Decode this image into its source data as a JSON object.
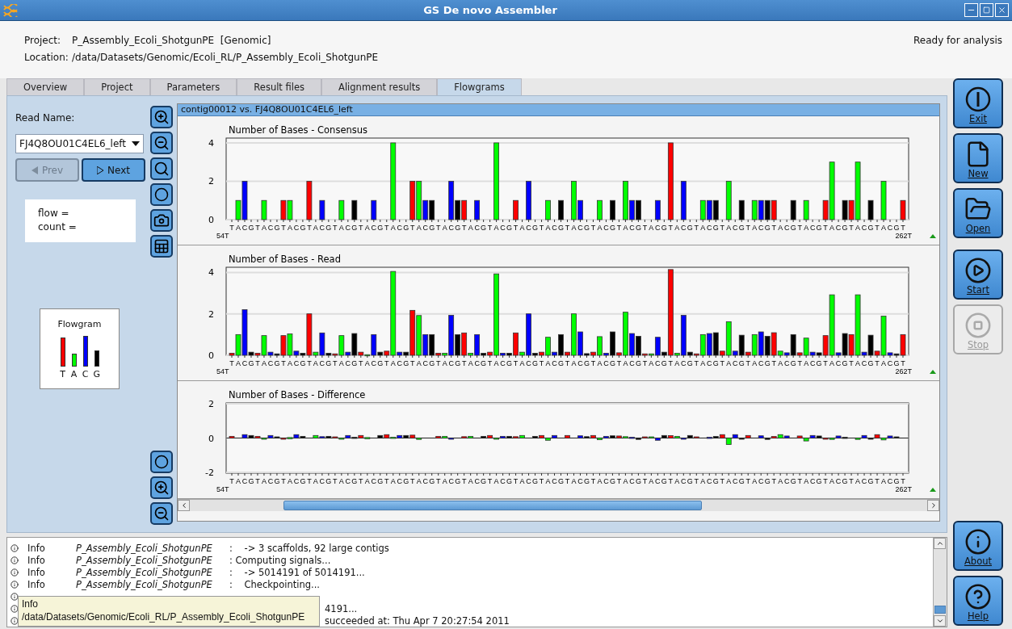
{
  "window": {
    "title": "GS De novo Assembler"
  },
  "header": {
    "project_label": "Project:",
    "project": "P_Assembly_Ecoli_ShotgunPE  [Genomic]",
    "location_label": "Location:",
    "location": "/data/Datasets/Genomic/Ecoli_RL/P_Assembly_Ecoli_ShotgunPE",
    "status": "Ready for analysis"
  },
  "tabs": [
    {
      "label": "Overview",
      "selected": false
    },
    {
      "label": "Project",
      "selected": false
    },
    {
      "label": "Parameters",
      "selected": false
    },
    {
      "label": "Result files",
      "selected": false
    },
    {
      "label": "Alignment results",
      "selected": false
    },
    {
      "label": "Flowgrams",
      "selected": true
    }
  ],
  "read_panel": {
    "label": "Read Name:",
    "read_name": "FJ4Q8OU01C4EL6_left",
    "buttons": [
      {
        "label": "Prev",
        "kind": "prev",
        "disabled": true
      },
      {
        "label": "Next",
        "kind": "next",
        "disabled": false
      }
    ],
    "info_lines": [
      "flow =",
      "count ="
    ],
    "legend": {
      "title": "Flowgram",
      "bases": [
        {
          "label": "T",
          "color": "#ff0000"
        },
        {
          "label": "A",
          "color": "#00ff00"
        },
        {
          "label": "C",
          "color": "#0000ff"
        },
        {
          "label": "G",
          "color": "#000000"
        }
      ]
    }
  },
  "flowgram": {
    "title": "contig00012 vs. FJ4Q8OU01C4EL6_left",
    "charts": [
      {
        "start_label": "54T",
        "end_label": "262T",
        "chart_data": {
          "type": "bar",
          "title": "Number of Bases - Consensus",
          "ylim": [
            0,
            4.25
          ],
          "yticks": [
            0,
            2,
            4
          ],
          "categories": [
            "T",
            "A",
            "C",
            "G",
            "T",
            "A",
            "C",
            "G",
            "T",
            "A",
            "C",
            "G",
            "T",
            "A",
            "C",
            "G",
            "T",
            "A",
            "C",
            "G",
            "T",
            "A",
            "C",
            "G",
            "T",
            "A",
            "C",
            "G",
            "T",
            "A",
            "C",
            "G",
            "T",
            "A",
            "C",
            "G",
            "T",
            "A",
            "C",
            "G",
            "T",
            "A",
            "C",
            "G",
            "T",
            "A",
            "C",
            "G",
            "T",
            "A",
            "C",
            "G",
            "T",
            "A",
            "C",
            "G",
            "T",
            "A",
            "C",
            "G",
            "T",
            "A",
            "C",
            "G",
            "T",
            "A",
            "C",
            "G",
            "T",
            "A",
            "C",
            "G",
            "T",
            "A",
            "C",
            "G",
            "T",
            "A",
            "C",
            "G",
            "T",
            "A",
            "C",
            "G",
            "T",
            "A",
            "C",
            "G",
            "T",
            "A",
            "C",
            "G",
            "T",
            "A",
            "C",
            "G",
            "T",
            "A",
            "C",
            "G",
            "T",
            "A",
            "C",
            "G",
            "T"
          ],
          "series": [
            {
              "values": [
                0,
                1,
                2,
                0,
                0,
                1,
                0,
                0,
                1,
                1,
                0,
                0,
                2,
                0,
                1,
                0,
                0,
                1,
                0,
                1,
                0,
                0,
                1,
                0,
                0,
                4,
                0,
                0,
                2,
                2,
                1,
                1,
                0,
                0,
                2,
                1,
                1,
                0,
                1,
                0,
                0,
                4,
                0,
                0,
                1,
                0,
                2,
                0,
                0,
                1,
                0,
                1,
                0,
                2,
                1,
                0,
                0,
                1,
                0,
                1,
                0,
                2,
                1,
                1,
                0,
                0,
                1,
                0,
                4,
                0,
                2,
                0,
                0,
                1,
                1,
                1,
                0,
                2,
                0,
                1,
                0,
                1,
                1,
                1,
                1,
                0,
                0,
                1,
                0,
                1,
                0,
                0,
                1,
                3,
                0,
                1,
                1,
                3,
                0,
                1,
                0,
                2,
                0,
                0,
                1
              ]
            }
          ]
        }
      },
      {
        "start_label": "54T",
        "end_label": "262T",
        "chart_data": {
          "type": "bar",
          "title": "Number of Bases - Read",
          "ylim": [
            0,
            4.25
          ],
          "yticks": [
            0,
            2,
            4
          ],
          "categories": [
            "T",
            "A",
            "C",
            "G",
            "T",
            "A",
            "C",
            "G",
            "T",
            "A",
            "C",
            "G",
            "T",
            "A",
            "C",
            "G",
            "T",
            "A",
            "C",
            "G",
            "T",
            "A",
            "C",
            "G",
            "T",
            "A",
            "C",
            "G",
            "T",
            "A",
            "C",
            "G",
            "T",
            "A",
            "C",
            "G",
            "T",
            "A",
            "C",
            "G",
            "T",
            "A",
            "C",
            "G",
            "T",
            "A",
            "C",
            "G",
            "T",
            "A",
            "C",
            "G",
            "T",
            "A",
            "C",
            "G",
            "T",
            "A",
            "C",
            "G",
            "T",
            "A",
            "C",
            "G",
            "T",
            "A",
            "C",
            "G",
            "T",
            "A",
            "C",
            "G",
            "T",
            "A",
            "C",
            "G",
            "T",
            "A",
            "C",
            "G",
            "T",
            "A",
            "C",
            "G",
            "T",
            "A",
            "C",
            "G",
            "T",
            "A",
            "C",
            "G",
            "T",
            "A",
            "C",
            "G",
            "T",
            "A",
            "C",
            "G",
            "T",
            "A",
            "C",
            "G",
            "T"
          ],
          "series": [
            {
              "values": [
                0.1,
                1.0,
                2.2,
                0.15,
                0.1,
                0.95,
                0.15,
                0.07,
                0.95,
                1.03,
                0.2,
                0.1,
                2.0,
                0.15,
                1.08,
                0.1,
                0.07,
                0.95,
                0.15,
                1.05,
                0.15,
                0.03,
                1.0,
                0.15,
                0.2,
                4.05,
                0.15,
                0.15,
                2.17,
                1.92,
                1.0,
                1.0,
                0.1,
                0.1,
                1.93,
                1.0,
                1.08,
                0.1,
                1.0,
                0.1,
                0.15,
                3.93,
                0.1,
                0.1,
                1.08,
                0.15,
                2.0,
                0.1,
                0.15,
                0.87,
                0.15,
                1.0,
                0.15,
                2.0,
                1.13,
                0.08,
                0.15,
                0.9,
                0.1,
                1.13,
                0.12,
                2.08,
                1.05,
                0.92,
                0.07,
                0.07,
                0.87,
                0.15,
                4.14,
                0.1,
                1.93,
                0.15,
                0.07,
                1.0,
                1.05,
                1.09,
                0.2,
                1.62,
                0.2,
                0.97,
                0.15,
                1.0,
                1.13,
                0.92,
                1.09,
                0.2,
                0.12,
                1.0,
                0.12,
                0.83,
                0.15,
                0.12,
                0.95,
                2.92,
                0.12,
                1.05,
                1.0,
                2.92,
                0.15,
                0.97,
                0.2,
                1.89,
                0.12,
                0.07,
                1.0
              ]
            }
          ]
        }
      },
      {
        "start_label": "54T",
        "end_label": "262T",
        "chart_data": {
          "type": "bar",
          "title": "Number of Bases - Difference",
          "ylim": [
            -2.05,
            2.05
          ],
          "yticks": [
            -2,
            0,
            2
          ],
          "categories": [
            "T",
            "A",
            "C",
            "G",
            "T",
            "A",
            "C",
            "G",
            "T",
            "A",
            "C",
            "G",
            "T",
            "A",
            "C",
            "G",
            "T",
            "A",
            "C",
            "G",
            "T",
            "A",
            "C",
            "G",
            "T",
            "A",
            "C",
            "G",
            "T",
            "A",
            "C",
            "G",
            "T",
            "A",
            "C",
            "G",
            "T",
            "A",
            "C",
            "G",
            "T",
            "A",
            "C",
            "G",
            "T",
            "A",
            "C",
            "G",
            "T",
            "A",
            "C",
            "G",
            "T",
            "A",
            "C",
            "G",
            "T",
            "A",
            "C",
            "G",
            "T",
            "A",
            "C",
            "G",
            "T",
            "A",
            "C",
            "G",
            "T",
            "A",
            "C",
            "G",
            "T",
            "A",
            "C",
            "G",
            "T",
            "A",
            "C",
            "G",
            "T",
            "A",
            "C",
            "G",
            "T",
            "A",
            "C",
            "G",
            "T",
            "A",
            "C",
            "G",
            "T",
            "A",
            "C",
            "G",
            "T",
            "A",
            "C",
            "G",
            "T",
            "A",
            "C",
            "G",
            "T"
          ],
          "series": [
            {
              "values": [
                0.1,
                0,
                0.2,
                0.15,
                0.1,
                -0.05,
                0.15,
                0.07,
                -0.05,
                0.03,
                0.2,
                0.1,
                0,
                0.15,
                0.08,
                0.1,
                0.07,
                -0.05,
                0.15,
                0.05,
                0.15,
                0.03,
                0,
                0.15,
                0.2,
                0.05,
                0.15,
                0.15,
                0.17,
                -0.08,
                0,
                0,
                0.1,
                0.1,
                -0.07,
                0,
                0.08,
                0.1,
                0,
                0.1,
                0.15,
                -0.07,
                0.1,
                0.1,
                0.08,
                0.15,
                0,
                0.1,
                0.15,
                -0.13,
                0.15,
                0,
                0.15,
                0,
                0.13,
                0.08,
                0.15,
                -0.1,
                0.1,
                0.13,
                0.12,
                0.08,
                0.05,
                -0.08,
                0.07,
                0.07,
                -0.13,
                0.15,
                0.14,
                0.1,
                -0.07,
                0.15,
                0.07,
                0,
                0.05,
                0.09,
                0.2,
                -0.38,
                0.2,
                -0.03,
                0.15,
                0,
                0.13,
                -0.08,
                0.09,
                0.2,
                0.12,
                0,
                0.12,
                -0.17,
                0.15,
                0.12,
                -0.05,
                -0.08,
                0.12,
                0.05,
                0,
                -0.08,
                0.15,
                -0.03,
                0.2,
                -0.11,
                0.12,
                0.07,
                0
              ]
            }
          ]
        }
      }
    ]
  },
  "actions": [
    {
      "label": "Exit",
      "kind": "exit",
      "disabled": false
    },
    {
      "label": "New",
      "kind": "new",
      "disabled": false
    },
    {
      "label": "Open",
      "kind": "open",
      "disabled": false
    },
    {
      "label": "Start",
      "kind": "start",
      "disabled": false
    },
    {
      "label": "Stop",
      "kind": "stop",
      "disabled": true
    }
  ],
  "help_actions": [
    {
      "label": "About",
      "kind": "about",
      "disabled": false
    },
    {
      "label": "Help",
      "kind": "help",
      "disabled": false
    }
  ],
  "log": {
    "rows": [
      {
        "kind": "full",
        "level": "Info",
        "source": "P_Assembly_Ecoli_ShotgunPE",
        "message": ":    -> 3 scaffolds, 92 large contigs"
      },
      {
        "kind": "full",
        "level": "Info",
        "source": "P_Assembly_Ecoli_ShotgunPE",
        "message": ": Computing signals..."
      },
      {
        "kind": "full",
        "level": "Info",
        "source": "P_Assembly_Ecoli_ShotgunPE",
        "message": ":    -> 5014191 of 5014191..."
      },
      {
        "kind": "full",
        "level": "Info",
        "source": "P_Assembly_Ecoli_ShotgunPE",
        "message": ":    Checkpointing..."
      },
      {
        "kind": "covered"
      },
      {
        "kind": "covered",
        "message": "4191..."
      },
      {
        "kind": "covered",
        "message": "succeeded at: Thu Apr 7 20:27:54 2011"
      }
    ],
    "tooltip": {
      "lines": [
        "Info",
        "/data/Datasets/Genomic/Ecoli_RL/P_Assembly_Ecoli_ShotgunPE"
      ]
    }
  }
}
